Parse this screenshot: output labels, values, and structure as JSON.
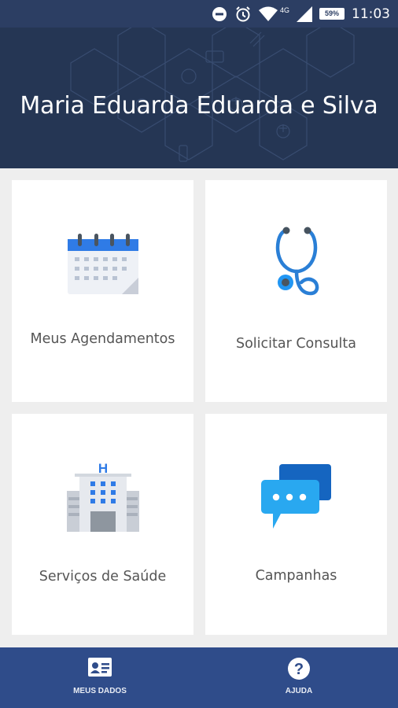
{
  "status_bar": {
    "network": "4G",
    "battery": "59%",
    "time": "11:03"
  },
  "header": {
    "user_name": "Maria Eduarda Eduarda e Silva"
  },
  "cards": [
    {
      "label": "Meus Agendamentos",
      "icon": "calendar-icon"
    },
    {
      "label": "Solicitar Consulta",
      "icon": "stethoscope-icon"
    },
    {
      "label": "Serviços de Saúde",
      "icon": "hospital-icon"
    },
    {
      "label": "Campanhas",
      "icon": "chat-bubbles-icon"
    }
  ],
  "bottom_nav": [
    {
      "label": "MEUS DADOS",
      "icon": "id-card-icon"
    },
    {
      "label": "AJUDA",
      "icon": "help-icon"
    }
  ],
  "colors": {
    "status_bar": "#2c3e63",
    "header": "#253654",
    "bottom_nav": "#2f4c8a",
    "accent_blue": "#2196f3"
  }
}
